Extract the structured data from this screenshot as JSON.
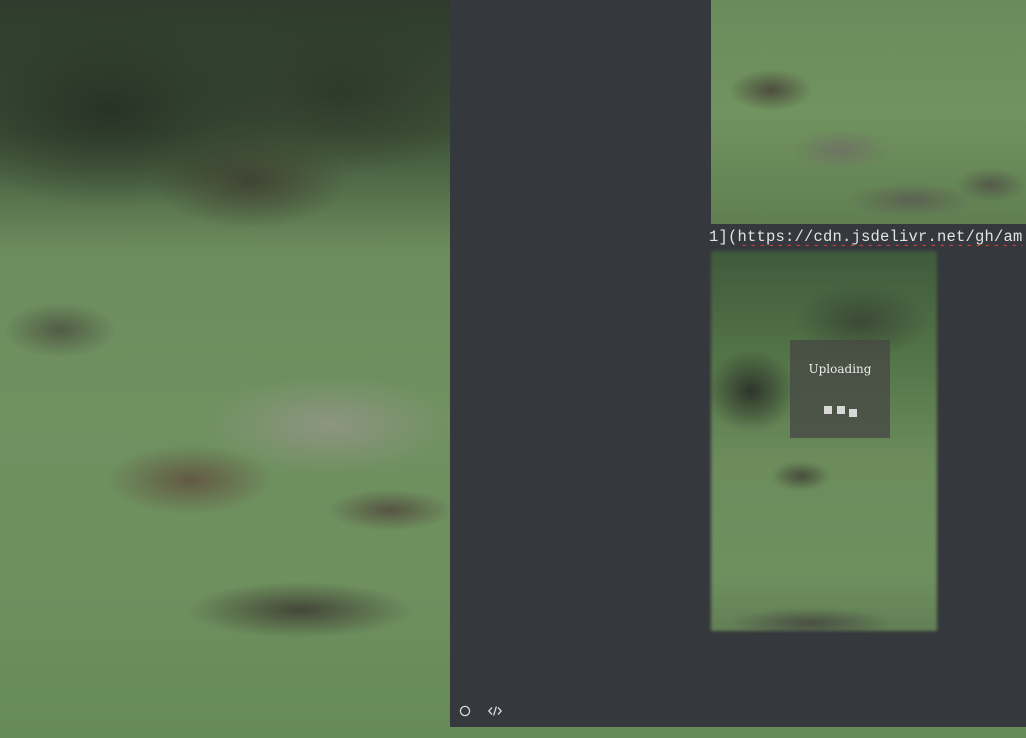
{
  "markdown_editor": {
    "line_prefix": "1](",
    "line_url": "https://cdn.jsdelivr.net/gh/am"
  },
  "upload_overlay": {
    "label": "Uploading"
  },
  "toolbar": {
    "icons": [
      "circle-icon",
      "code-icon"
    ]
  },
  "colors": {
    "editor_bg": "#35383c",
    "text": "#e3e3e3",
    "spellcheck_underline": "#d13b3b"
  }
}
